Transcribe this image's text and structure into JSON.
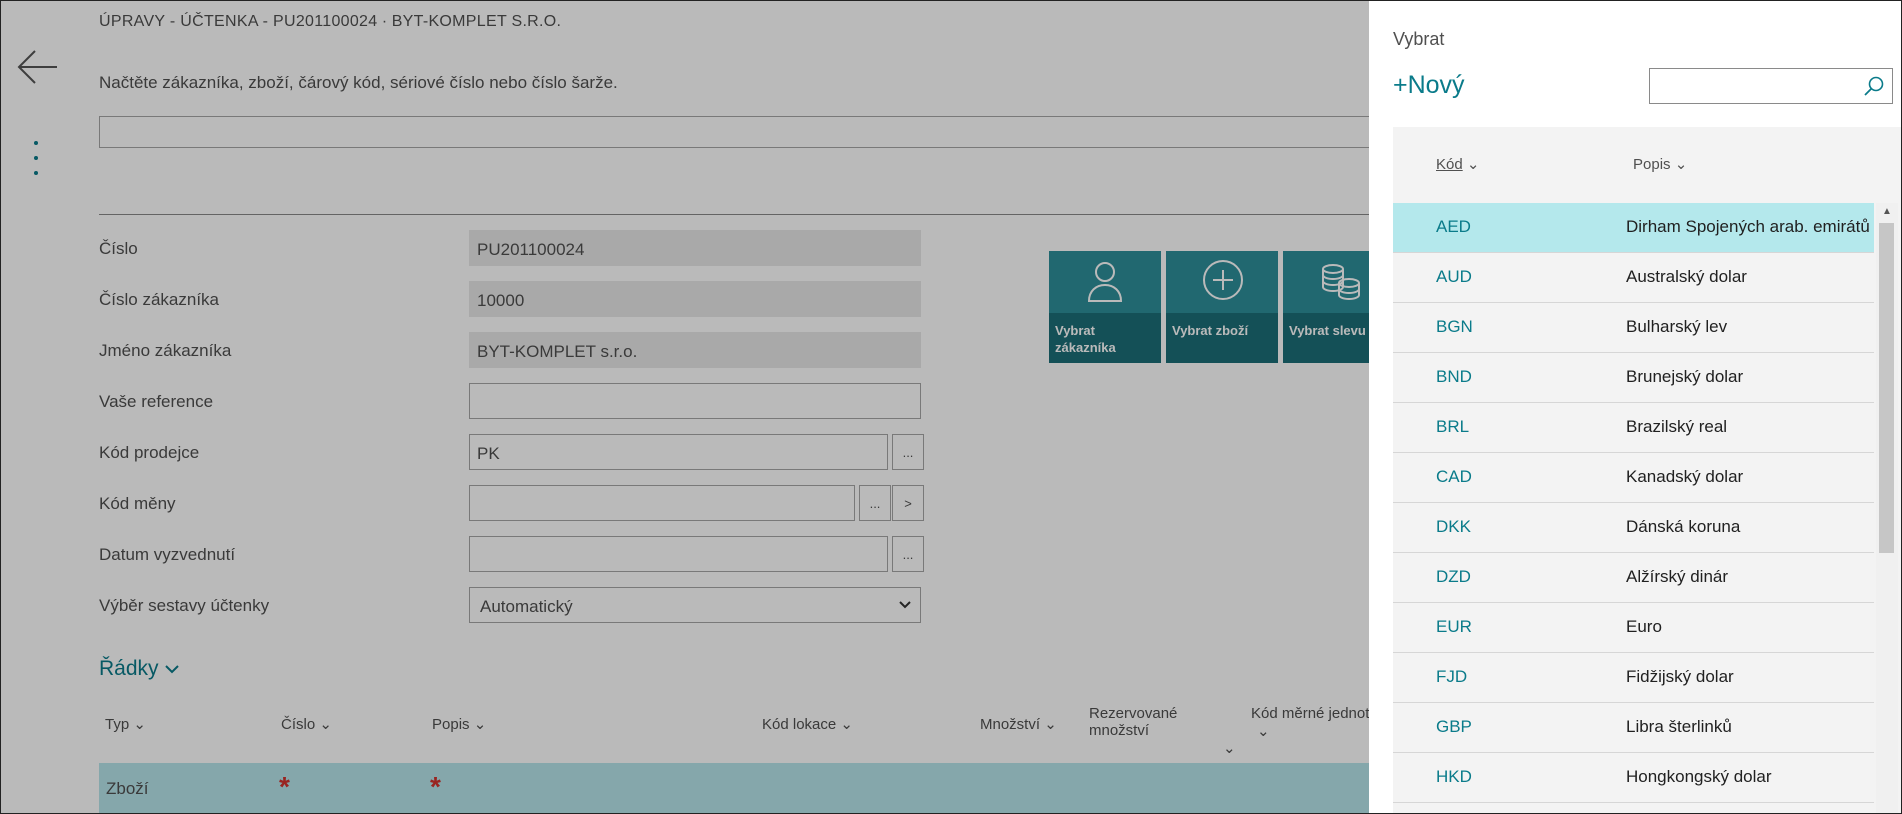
{
  "page": {
    "title": "ÚPRAVY - ÚČTENKA - PU201100024 ∙ BYT-KOMPLET S.R.O.",
    "scan_label": "Načtěte zákazníka, zboží, čárový kód, sériové číslo nebo číslo šarže.",
    "scan_value": ""
  },
  "form": {
    "cislo": {
      "label": "Číslo",
      "value": "PU201100024"
    },
    "cislo_zakaznika": {
      "label": "Číslo zákazníka",
      "value": "10000"
    },
    "jmeno_zakaznika": {
      "label": "Jméno zákazníka",
      "value": "BYT-KOMPLET s.r.o."
    },
    "vase_reference": {
      "label": "Vaše reference",
      "value": ""
    },
    "kod_prodejce": {
      "label": "Kód prodejce",
      "value": "PK",
      "lookup": "..."
    },
    "kod_meny": {
      "label": "Kód měny",
      "value": "",
      "lookup": "...",
      "drill": ">"
    },
    "datum_vyzvednuti": {
      "label": "Datum vyzvednutí",
      "value": "",
      "lookup": "..."
    },
    "vyber_sestavy": {
      "label": "Výběr sestavy účtenky",
      "value": "Automatický"
    }
  },
  "actions": {
    "vybrat_zakaznika": "Vybrat zákazníka",
    "vybrat_zbozi": "Vybrat zboží",
    "vybrat_slevu": "Vybrat slevu"
  },
  "lines": {
    "section_title": "Řádky",
    "columns": {
      "typ": "Typ",
      "cislo": "Číslo",
      "popis": "Popis",
      "kod_lokace": "Kód lokace",
      "mnozstvi": "Množství",
      "rezervovane_mnozstvi": "Rezervované množství",
      "kod_merne_jednotky": "Kód měrné jednot"
    },
    "rows": [
      {
        "typ": "Zboží",
        "cislo_required": "*",
        "popis_required": "*"
      }
    ]
  },
  "lookup": {
    "title": "Vybrat",
    "new_label": "+Nový",
    "search_placeholder": "",
    "columns": {
      "kod": "Kód",
      "popis": "Popis"
    },
    "rows": [
      {
        "kod": "AED",
        "popis": "Dirham Spojených arab. emirátů"
      },
      {
        "kod": "AUD",
        "popis": "Australský dolar"
      },
      {
        "kod": "BGN",
        "popis": "Bulharský lev"
      },
      {
        "kod": "BND",
        "popis": "Brunejský dolar"
      },
      {
        "kod": "BRL",
        "popis": "Brazilský real"
      },
      {
        "kod": "CAD",
        "popis": "Kanadský dolar"
      },
      {
        "kod": "DKK",
        "popis": "Dánská koruna"
      },
      {
        "kod": "DZD",
        "popis": "Alžírský dinár"
      },
      {
        "kod": "EUR",
        "popis": "Euro"
      },
      {
        "kod": "FJD",
        "popis": "Fidžijský dolar"
      },
      {
        "kod": "GBP",
        "popis": "Libra šterlinků"
      },
      {
        "kod": "HKD",
        "popis": "Hongkongský dolar"
      }
    ],
    "selected_index": 0
  },
  "colors": {
    "accent": "#0a7b8a",
    "selected_row": "#b4e8ec",
    "tile": "#2e8f9a",
    "tile_band": "#1c6e78",
    "required": "#d2322d"
  },
  "icons": {
    "back": "back-arrow-icon",
    "more": "more-vertical-icon",
    "customer": "person-icon",
    "item": "plus-circle-icon",
    "discount": "coins-icon",
    "search": "search-icon",
    "sort": "chevron-down-icon"
  }
}
